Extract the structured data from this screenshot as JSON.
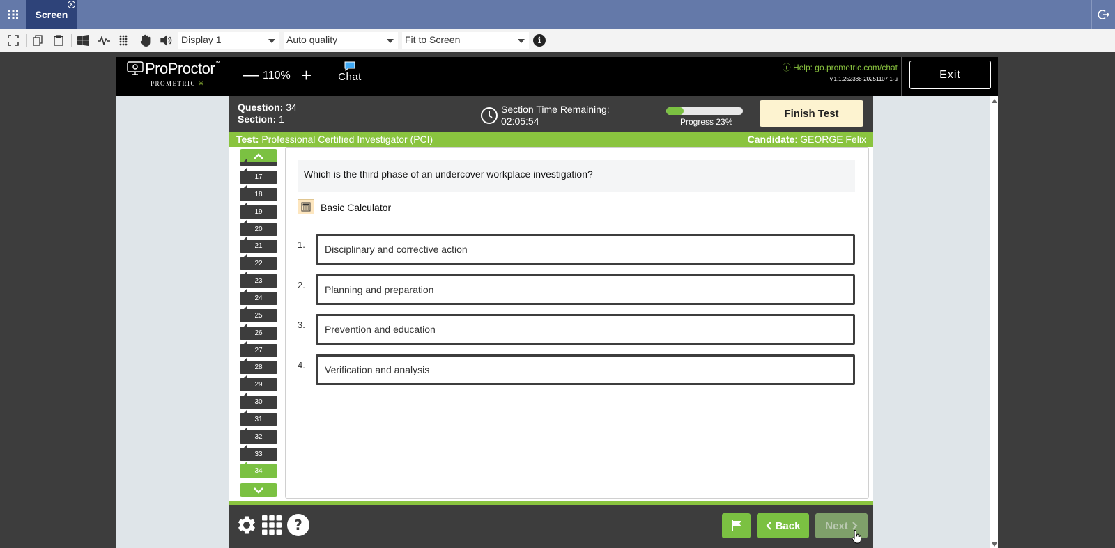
{
  "session": {
    "tab_label": "Screen"
  },
  "toolbar": {
    "display_select": "Display 1",
    "quality_select": "Auto quality",
    "fit_select": "Fit to Screen",
    "info_label": "i"
  },
  "header": {
    "logo_text": "ProProctor",
    "logo_tm": "™",
    "logo_sub": "PROMETRIC",
    "zoom_minus": "—",
    "zoom_value": "110%",
    "zoom_plus": "+",
    "chat_label": "Chat",
    "help_text": "Help: go.prometric.com/chat",
    "version_text": "v.1.1.252388-20251107.1-u",
    "exit_label": "Exit"
  },
  "exam": {
    "question_label": "Question:",
    "question_number": "34",
    "section_label": "Section:",
    "section_number": "1",
    "time_label": "Section Time Remaining:",
    "time_value": "02:05:54",
    "progress_label": "Progress 23%",
    "progress_fraction": 0.23,
    "finish_label": "Finish Test",
    "test_label": "Test:",
    "test_name": "Professional Certified Investigator (PCI)",
    "candidate_label": "Candidate",
    "candidate_name": ": GEORGE Felix"
  },
  "navigator": {
    "items": [
      "17",
      "18",
      "19",
      "20",
      "21",
      "22",
      "23",
      "24",
      "25",
      "26",
      "27",
      "28",
      "29",
      "30",
      "31",
      "32",
      "33",
      "34"
    ],
    "current": "34"
  },
  "question": {
    "stem": "Which is the third phase of an undercover workplace investigation?",
    "calculator_label": "Basic Calculator",
    "options": [
      {
        "num": "1.",
        "text": "Disciplinary and corrective action"
      },
      {
        "num": "2.",
        "text": "Planning and preparation"
      },
      {
        "num": "3.",
        "text": "Prevention and education"
      },
      {
        "num": "4.",
        "text": "Verification and analysis"
      }
    ]
  },
  "footer": {
    "back_label": "Back",
    "next_label": "Next"
  },
  "colors": {
    "accent_green": "#7bc142",
    "session_blue": "#6479a9",
    "tab_navy": "#2e4379",
    "finish_bg": "#fdf3d0"
  }
}
